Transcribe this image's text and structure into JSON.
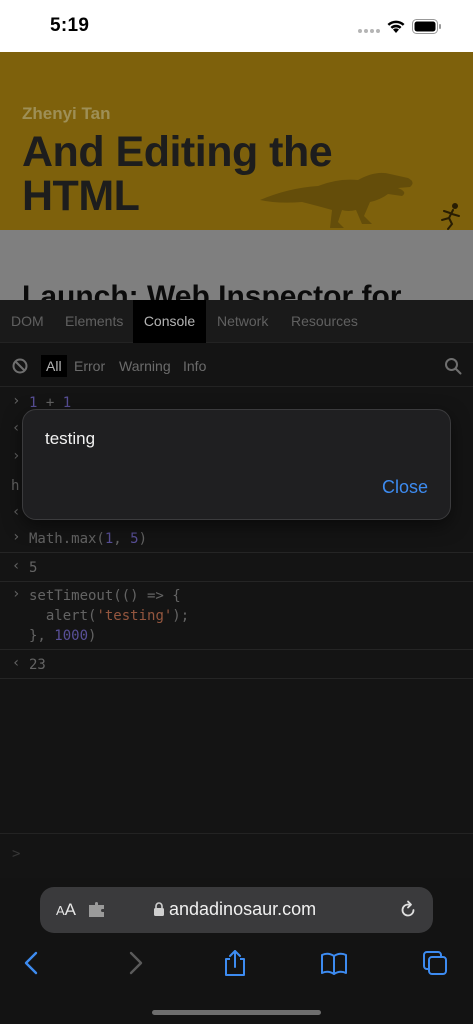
{
  "status_bar": {
    "time": "5:19"
  },
  "web_page": {
    "author": "Zhenyi Tan",
    "title": "And Editing the HTML",
    "heading": "Launch: Web Inspector for"
  },
  "inspector": {
    "tabs": [
      {
        "label": "DOM",
        "active": false
      },
      {
        "label": "Elements",
        "active": false
      },
      {
        "label": "Console",
        "active": true
      },
      {
        "label": "Network",
        "active": false
      },
      {
        "label": "Resources",
        "active": false
      }
    ],
    "filters": [
      {
        "label": "All",
        "active": true
      },
      {
        "label": "Error",
        "active": false
      },
      {
        "label": "Warning",
        "active": false
      },
      {
        "label": "Info",
        "active": false
      }
    ],
    "entries": [
      {
        "type": "input",
        "text": "1 + 1"
      },
      {
        "type": "output",
        "text": ""
      },
      {
        "type": "input",
        "text": ""
      },
      {
        "type": "output",
        "text": "h"
      },
      {
        "type": "output",
        "text": ""
      },
      {
        "type": "input",
        "text": "Math.max(1, 5)"
      },
      {
        "type": "output",
        "text": "5"
      },
      {
        "type": "input",
        "text": "setTimeout(() => {\n  alert('testing');\n}, 1000)"
      },
      {
        "type": "output",
        "text": "23"
      }
    ],
    "prompt_symbol": ">"
  },
  "alert": {
    "message": "testing",
    "close_label": "Close"
  },
  "toolbar": {
    "aa_label": "AA",
    "url": "andadinosaur.com"
  },
  "colors": {
    "hero_background": "#b58c12",
    "link_blue": "#3d8bf0",
    "number_purple": "#7f72d9",
    "string_orange": "#d47b5a"
  }
}
